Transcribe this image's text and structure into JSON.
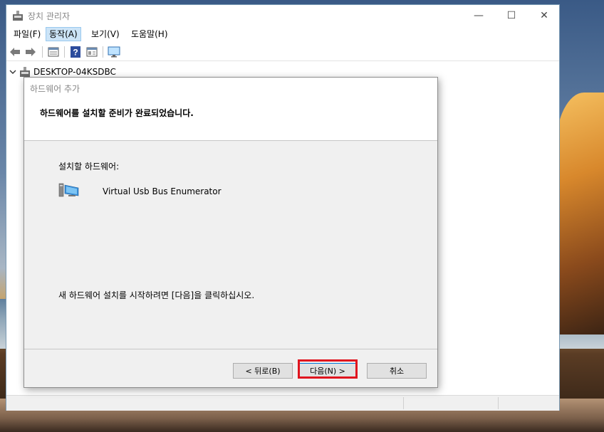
{
  "window": {
    "title": "장치 관리자",
    "controls": {
      "minimize": "—",
      "maximize": "☐",
      "close": "✕"
    }
  },
  "menu": [
    {
      "label": "파일(F)",
      "active": false
    },
    {
      "label": "동작(A)",
      "active": true
    },
    {
      "label": "보기(V)",
      "active": false
    },
    {
      "label": "도움말(H)",
      "active": false
    }
  ],
  "toolbar": {
    "icons": [
      "back-icon",
      "forward-icon",
      "properties-icon",
      "help-icon",
      "view-icon",
      "monitor-icon"
    ]
  },
  "tree": {
    "root_label": "DESKTOP-04KSDBC",
    "expanded": true
  },
  "dialog": {
    "title": "하드웨어 추가",
    "heading": "하드웨어를 설치할 준비가 완료되었습니다.",
    "install_label": "설치할 하드웨어:",
    "hardware_name": "Virtual Usb Bus Enumerator",
    "instruction": "새 하드웨어 설치를 시작하려면 [다음]을 클릭하십시오.",
    "buttons": {
      "back": "< 뒤로(B)",
      "next": "다음(N) >",
      "cancel": "취소"
    }
  },
  "colors": {
    "highlight": "#e0141e",
    "menu_active_bg": "#cce4f7",
    "dialog_body_bg": "#f0f0f0"
  }
}
